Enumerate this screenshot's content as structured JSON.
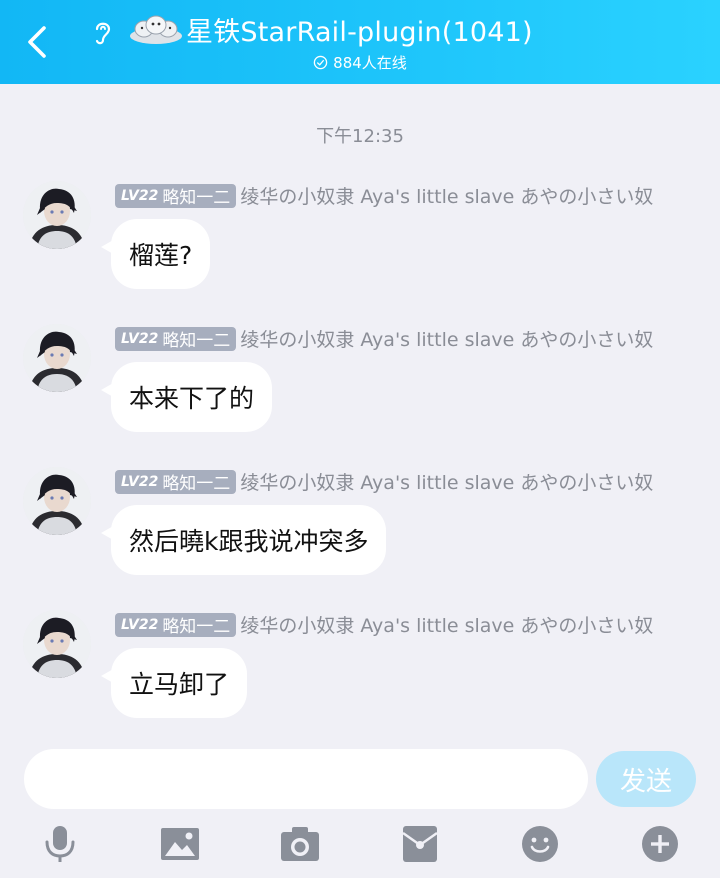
{
  "header": {
    "title": "星铁StarRail-plugin(1041)",
    "online_count": "884人在线"
  },
  "chat": {
    "timestamp": "下午12:35",
    "messages": [
      {
        "level": "LV22",
        "title": "略知一二",
        "nickname": "绫华の小奴隶 Aya's little slave あやの小さい奴",
        "text": "榴莲?"
      },
      {
        "level": "LV22",
        "title": "略知一二",
        "nickname": "绫华の小奴隶 Aya's little slave あやの小さい奴",
        "text": "本来下了的"
      },
      {
        "level": "LV22",
        "title": "略知一二",
        "nickname": "绫华の小奴隶 Aya's little slave あやの小さい奴",
        "text": "然后曉k跟我说冲突多"
      },
      {
        "level": "LV22",
        "title": "略知一二",
        "nickname": "绫华の小奴隶 Aya's little slave あやの小さい奴",
        "text": "立马卸了"
      }
    ]
  },
  "input": {
    "value": "",
    "placeholder": "",
    "send_label": "发送"
  },
  "toolbar": {
    "icons": [
      "mic-icon",
      "image-icon",
      "camera-icon",
      "red-packet-icon",
      "emoji-icon",
      "plus-icon"
    ]
  },
  "colors": {
    "header": "#12b7f5",
    "background": "#f0f0f6",
    "send_disabled": "#b9e6fa",
    "badge": "#a7aebe"
  }
}
